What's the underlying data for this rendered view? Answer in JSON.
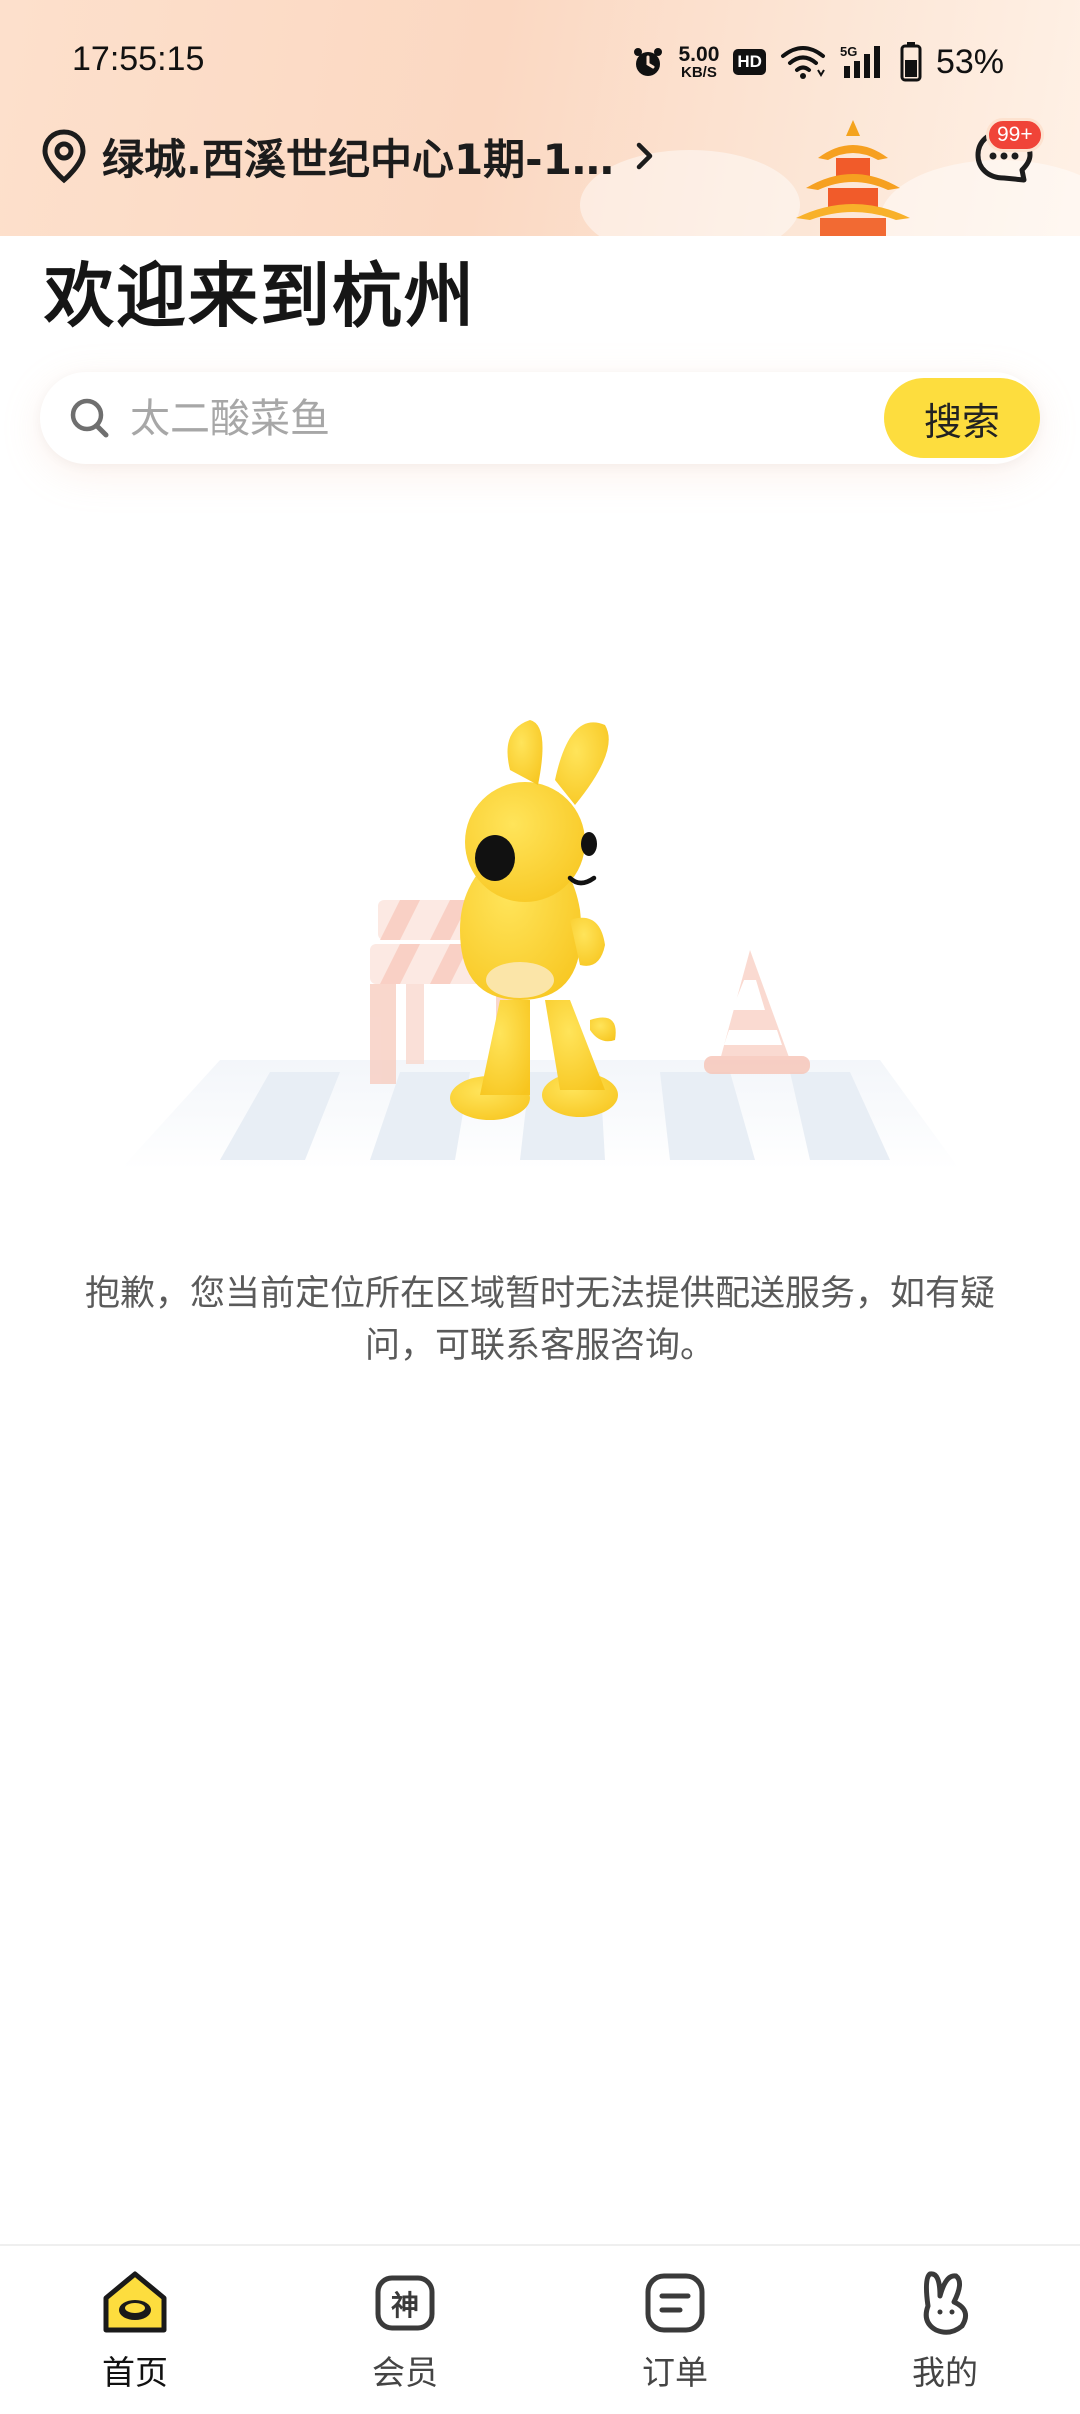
{
  "status_bar": {
    "time": "17:55:15",
    "net_speed_value": "5.00",
    "net_speed_unit": "KB/S",
    "hd_label": "HD",
    "signal_label": "5G",
    "battery_percent": "53%"
  },
  "header": {
    "location": "绿城.西溪世纪中心1期-1…",
    "message_badge": "99+"
  },
  "welcome_title": "欢迎来到杭州",
  "search": {
    "placeholder": "太二酸菜鱼",
    "button_label": "搜索"
  },
  "empty_state": {
    "message": "抱歉，您当前定位所在区域暂时无法提供配送服务，如有疑问，可联系客服咨询。"
  },
  "tab_bar": {
    "tabs": [
      {
        "label": "首页",
        "icon": "home-icon",
        "active": true
      },
      {
        "label": "会员",
        "icon": "member-icon",
        "active": false
      },
      {
        "label": "订单",
        "icon": "order-icon",
        "active": false
      },
      {
        "label": "我的",
        "icon": "profile-icon",
        "active": false
      }
    ]
  },
  "colors": {
    "accent_yellow": "#fddd3e",
    "badge_red": "#f04438",
    "header_peach": "#fbd8c2"
  }
}
